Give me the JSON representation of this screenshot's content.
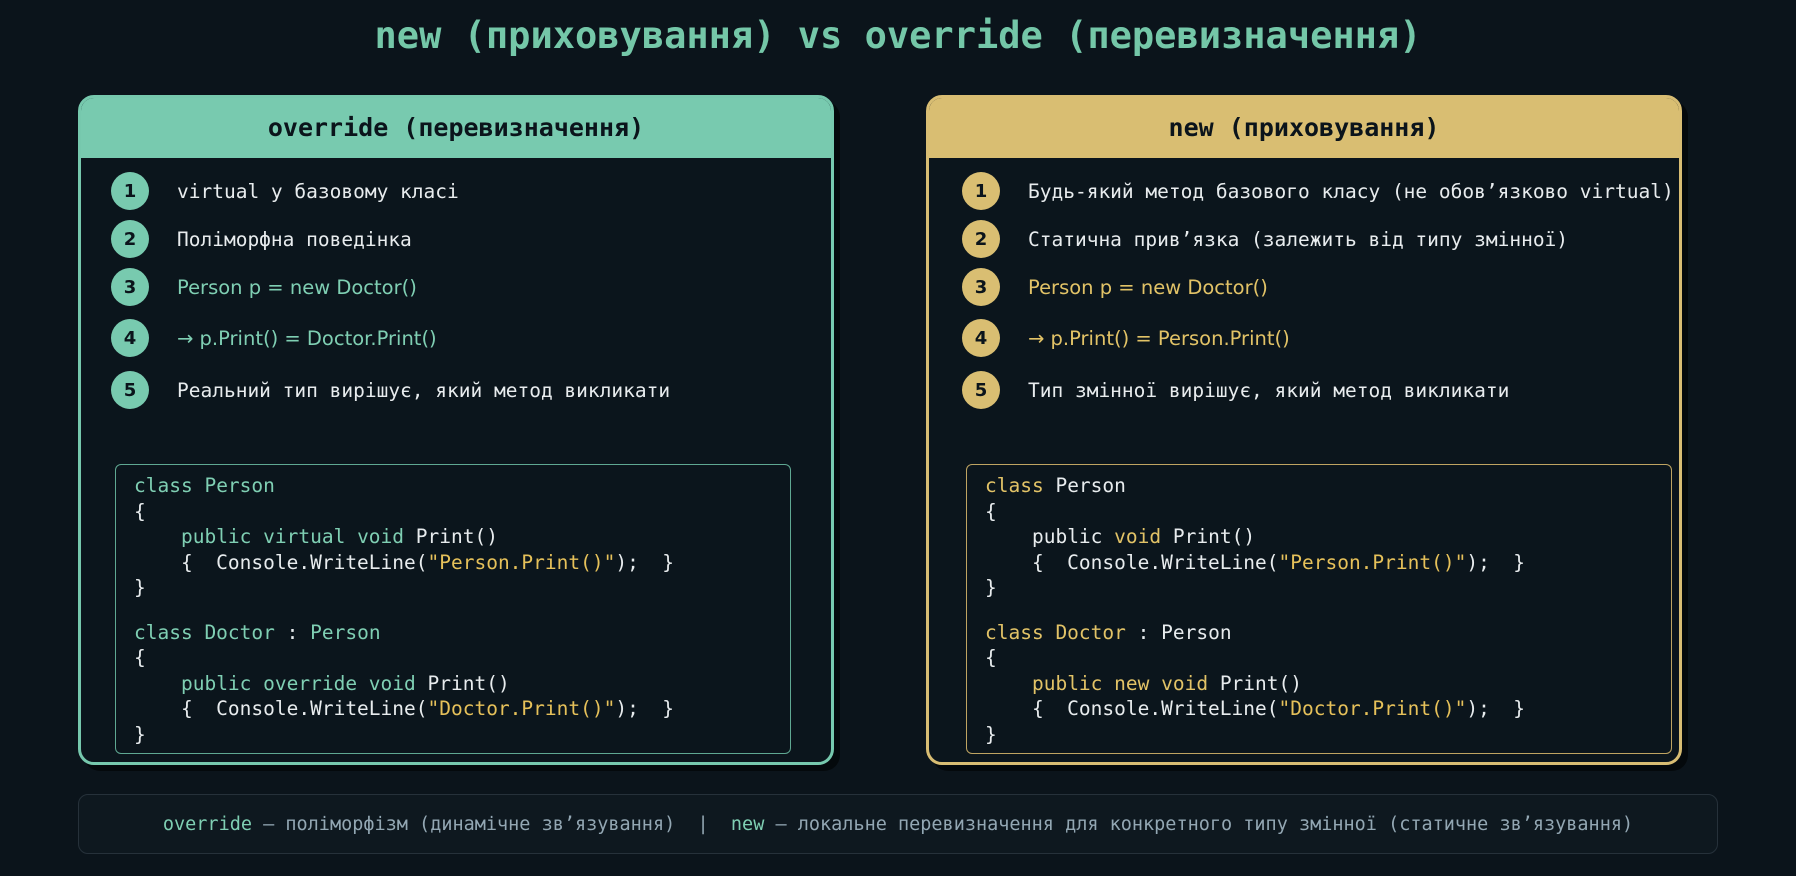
{
  "title": "new (приховування) vs override (перевизначення)",
  "left_card": {
    "header": "override (перевизначення)",
    "steps": [
      {
        "num": "1",
        "text": "virtual у базовому класі"
      },
      {
        "num": "2",
        "text": "Поліморфна поведінка"
      },
      {
        "num": "3",
        "text": "Person p = new Doctor()"
      },
      {
        "num": "4",
        "text": "→ p.Print() = Doctor.Print()"
      },
      {
        "num": "5",
        "text": "Реальний тип вирішує, який метод викликати"
      }
    ],
    "code": {
      "l1_kw": "class",
      "l1_name": "Person",
      "l2": "{",
      "l3_indent": "    ",
      "l3_kw": "public virtual void",
      "l3_rest": " Print()",
      "l4_pre": "    {  Console.WriteLine(",
      "l4_str": "\"Person.Print()\"",
      "l4_post": ");  }",
      "l5": "}",
      "l6_kw": "class Doctor",
      "l6_sep": " : ",
      "l6_base": "Person",
      "l7": "{",
      "l8_indent": "    ",
      "l8_kw": "public override void",
      "l8_rest": " Print()",
      "l9_pre": "    {  Console.WriteLine(",
      "l9_str": "\"Doctor.Print()\"",
      "l9_post": ");  }",
      "l10": "}"
    }
  },
  "right_card": {
    "header": "new (приховування)",
    "steps": [
      {
        "num": "1",
        "text": "Будь-який метод базового класу (не обов’язково virtual)"
      },
      {
        "num": "2",
        "text": "Статична прив’язка (залежить від типу змінної)"
      },
      {
        "num": "3",
        "text": "Person p = new Doctor()"
      },
      {
        "num": "4",
        "text": "→ p.Print() = Person.Print()"
      },
      {
        "num": "5",
        "text": "Тип змінної вирішує, який метод викликати"
      }
    ],
    "code": {
      "l1_kw": "class",
      "l1_name": "Person",
      "l2": "{",
      "l3_indent": "    ",
      "l3_pub": "public",
      "l3_kw": "void",
      "l3_rest": " Print()",
      "l4_pre": "    {  Console.WriteLine(",
      "l4_str": "\"Person.Print()\"",
      "l4_post": ");  }",
      "l5": "}",
      "l6_kw": "class Doctor",
      "l6_sep": " : ",
      "l6_base": "Person",
      "l7": "{",
      "l8_indent": "    ",
      "l8_kw": "public new void",
      "l8_rest": " Print()",
      "l9_pre": "    {  Console.WriteLine(",
      "l9_str": "\"Doctor.Print()\"",
      "l9_post": ");  }",
      "l10": "}"
    }
  },
  "footer": {
    "override_kw": "override",
    "override_text": " — поліморфізм (динамічне зв’язування)  |  ",
    "new_kw": "new",
    "new_text": " — локальне перевизначення для конкретного типу змінної (статичне зв’язування)"
  },
  "colors": {
    "background": "#0b141b",
    "override_accent": "#78caaf",
    "new_accent": "#d9be72",
    "string_literal": "#e6c15a"
  }
}
